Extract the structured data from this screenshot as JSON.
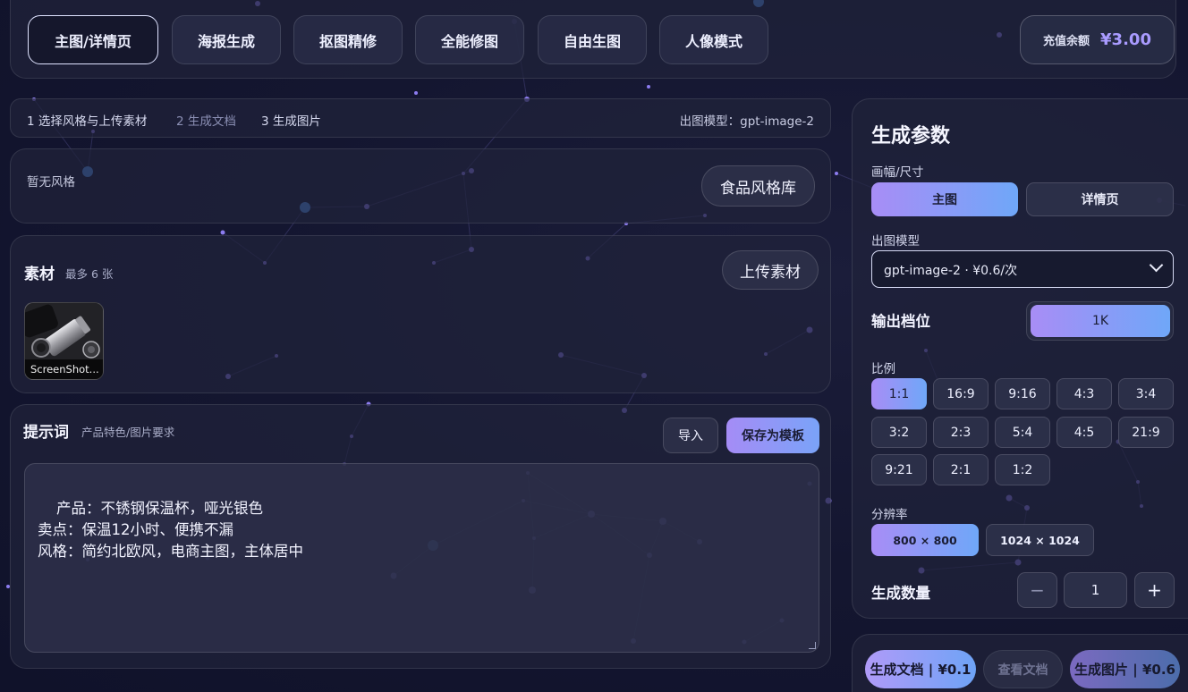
{
  "nav": {
    "tabs": [
      {
        "label": "主图/详情页",
        "active": true
      },
      {
        "label": "海报生成",
        "active": false
      },
      {
        "label": "抠图精修",
        "active": false
      },
      {
        "label": "全能修图",
        "active": false
      },
      {
        "label": "自由生图",
        "active": false
      },
      {
        "label": "人像模式",
        "active": false
      }
    ],
    "balance_label": "充值余额",
    "balance_value": "¥3.00"
  },
  "steps": {
    "step1": "1 选择风格与上传素材",
    "step2": "2 生成文档",
    "step3": "3 生成图片",
    "model_info": "出图模型：gpt-image-2"
  },
  "style": {
    "empty_text": "暂无风格",
    "library_button": "食品风格库"
  },
  "material": {
    "title": "素材",
    "hint": "最多 6 张",
    "upload_button": "上传素材",
    "items": [
      {
        "caption": "ScreenShot..."
      }
    ]
  },
  "prompt": {
    "title": "提示词",
    "hint": "产品特色/图片要求",
    "import_button": "导入",
    "save_template_button": "保存为模板",
    "text": "产品：不锈钢保温杯，哑光银色\n卖点：保温12小时、便携不漏\n风格：简约北欧风，电商主图，主体居中"
  },
  "params": {
    "title": "生成参数",
    "canvas_label": "画幅/尺寸",
    "canvas_options": [
      {
        "label": "主图",
        "active": true
      },
      {
        "label": "详情页",
        "active": false
      }
    ],
    "model_label": "出图模型",
    "model_selected": "gpt-image-2 · ¥0.6/次",
    "tier_label": "输出档位",
    "tier_selected": "1K",
    "ratio_label": "比例",
    "ratios": [
      "1:1",
      "16:9",
      "9:16",
      "4:3",
      "3:4",
      "3:2",
      "2:3",
      "5:4",
      "4:5",
      "21:9",
      "9:21",
      "2:1",
      "1:2"
    ],
    "ratio_selected": "1:1",
    "resolution_label": "分辨率",
    "resolutions": [
      {
        "label": "800 × 800",
        "active": true
      },
      {
        "label": "1024 × 1024",
        "active": false
      }
    ],
    "quantity_label": "生成数量",
    "quantity": "1",
    "minus": "−",
    "plus": "+"
  },
  "actions": {
    "generate_doc": "生成文档 | ¥0.1",
    "view_doc": "查看文档",
    "generate_image": "生成图片 | ¥0.6"
  },
  "colors": {
    "accent_from": "#a88df6",
    "accent_to": "#6fa7f8",
    "balance": "#a99bff",
    "background": "#12142a"
  }
}
